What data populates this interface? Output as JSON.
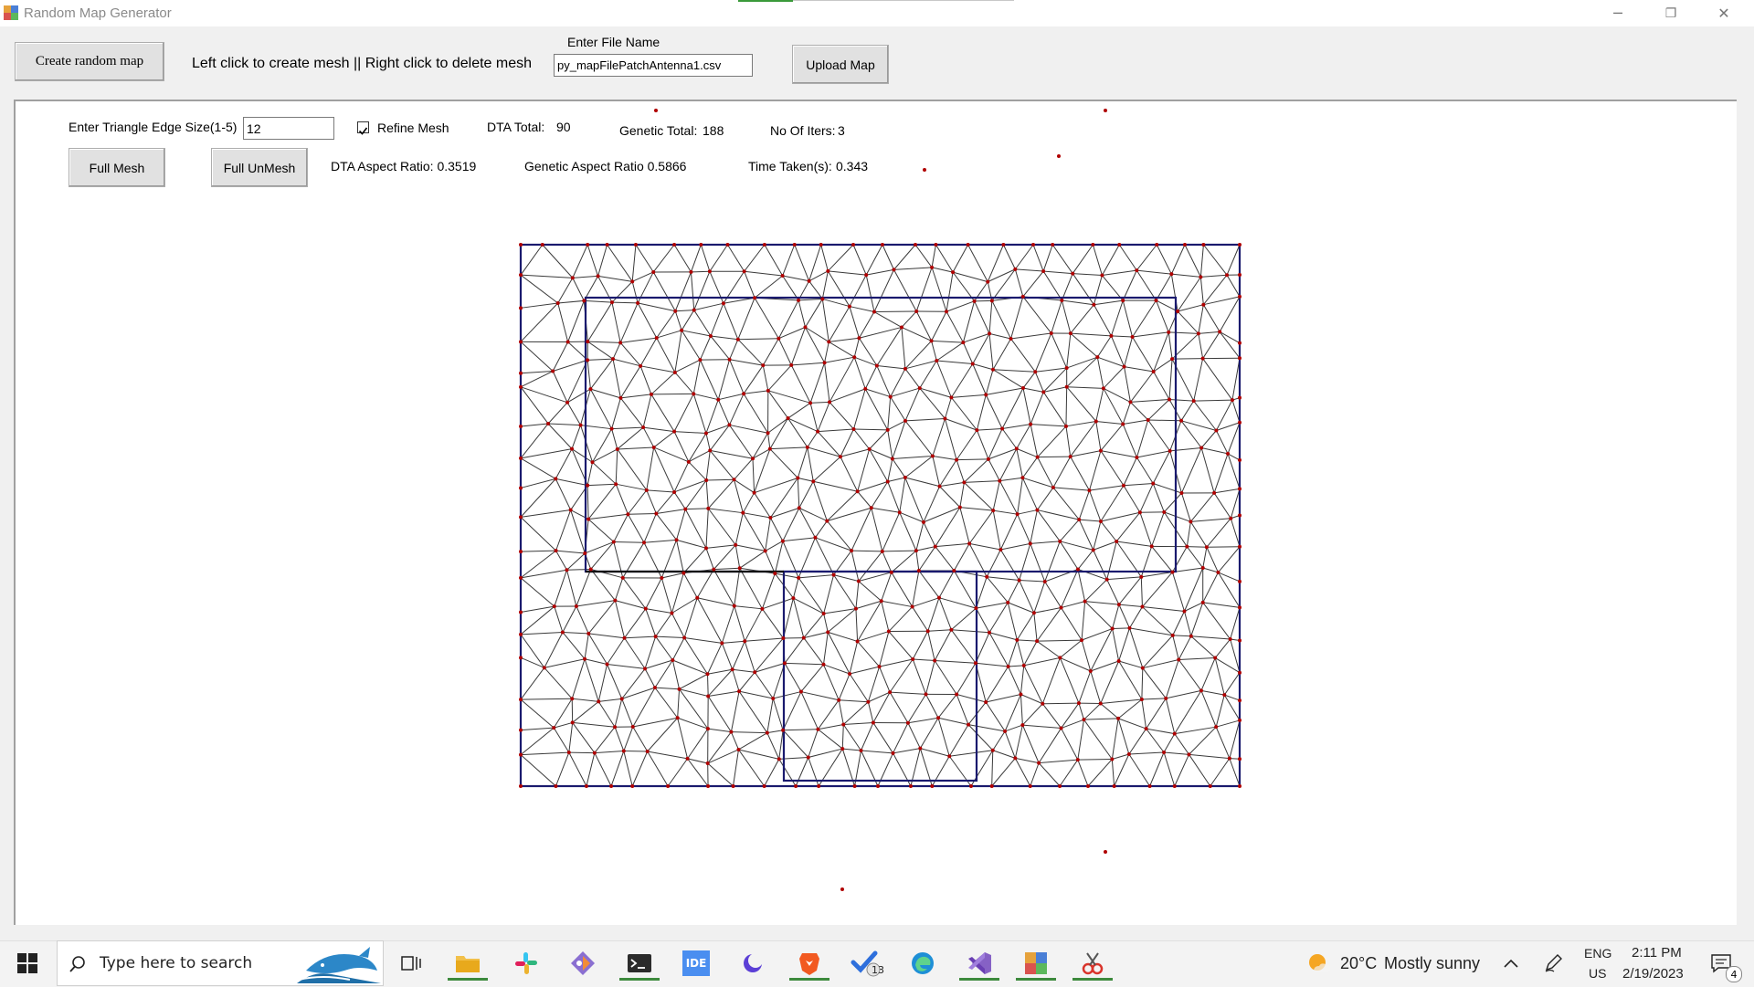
{
  "window": {
    "title": "Random Map Generator",
    "minimize_glyph": "─",
    "restore_glyph": "❐",
    "close_glyph": "✕"
  },
  "toolbar": {
    "create_random_map": "Create random map",
    "instructions": "Left click to create mesh || Right click to delete mesh",
    "file_name_label": "Enter File Name",
    "file_name_value": "py_mapFilePatchAntenna1.csv",
    "upload_map": "Upload Map"
  },
  "controls": {
    "edge_size_label": "Enter Triangle Edge Size(1-5)",
    "edge_size_value": "12",
    "refine_mesh_label": "Refine Mesh",
    "refine_mesh_checked": true,
    "dta_total_label": "DTA Total:",
    "dta_total_value": "90",
    "genetic_total_label": "Genetic Total:",
    "genetic_total_value": "188",
    "iters_label": "No Of Iters:",
    "iters_value": "3",
    "full_mesh": "Full Mesh",
    "full_unmesh": "Full UnMesh",
    "dta_aspect": "DTA Aspect Ratio: 0.3519",
    "genetic_aspect": "Genetic Aspect Ratio 0.5866",
    "time_taken_label": "Time Taken(s):",
    "time_taken_value": "0.343"
  },
  "mesh": {
    "edge_color": "#3a3a3a",
    "boundary_color": "#1a1a6e",
    "node_color": "#b00000"
  },
  "taskbar": {
    "search_placeholder": "Type here to search",
    "weather_temp": "20°C",
    "weather_desc": "Mostly sunny",
    "lang_top": "ENG",
    "lang_bottom": "US",
    "time": "2:11 PM",
    "date": "2/19/2023",
    "notification_count": "4",
    "todo_badge": "13",
    "ide_label": "IDE"
  }
}
